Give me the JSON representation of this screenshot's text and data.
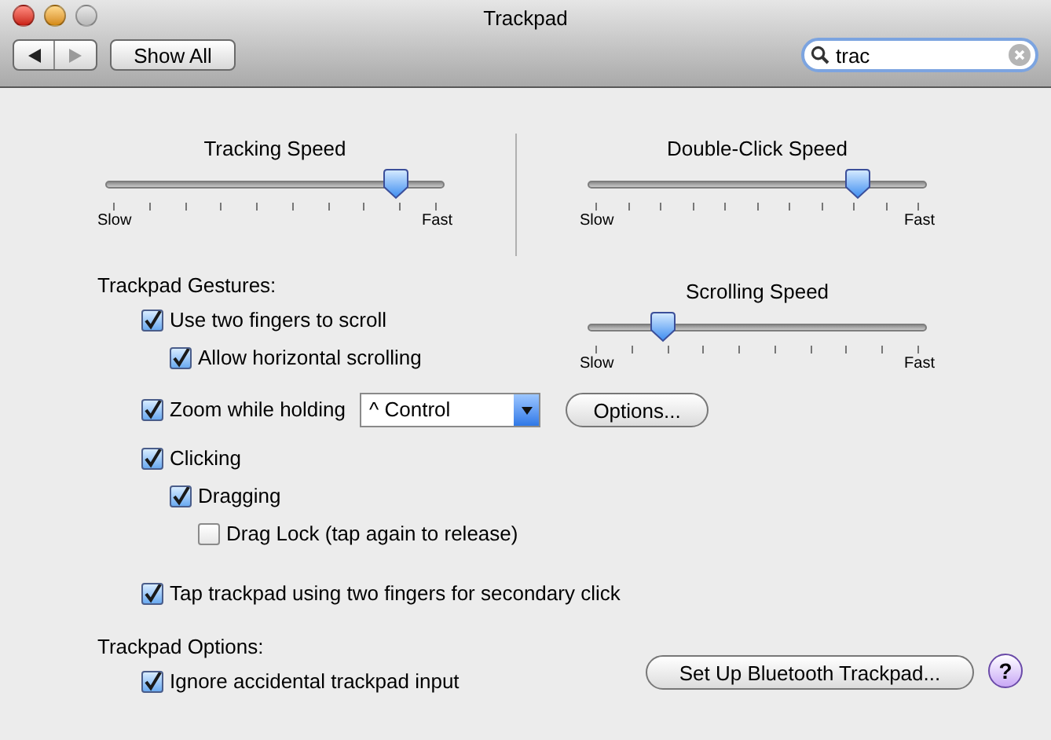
{
  "window": {
    "title": "Trackpad"
  },
  "toolbar": {
    "show_all": "Show All",
    "search": {
      "value": "trac"
    }
  },
  "sliders": [
    {
      "title": "Tracking Speed",
      "level": 0.86,
      "min_label": "Slow",
      "max_label": "Fast"
    },
    {
      "title": "Double-Click Speed",
      "level": 0.8,
      "min_label": "Slow",
      "max_label": "Fast"
    }
  ],
  "gestures": {
    "heading": "Trackpad Gestures:",
    "scrolling_speed": {
      "title": "Scrolling Speed",
      "level": 0.22,
      "min_label": "Slow",
      "max_label": "Fast"
    },
    "items": [
      {
        "kind": "checkbox",
        "label": "Use two fingers to scroll",
        "checked": true,
        "children": [
          {
            "kind": "checkbox",
            "label": "Allow horizontal scrolling",
            "checked": true
          }
        ]
      },
      {
        "kind": "checkbox_dropdown",
        "label": "Zoom while holding",
        "checked": true,
        "dropdown": "^ Control",
        "button": "Options..."
      },
      {
        "kind": "checkbox",
        "label": "Clicking",
        "checked": true,
        "children": [
          {
            "kind": "checkbox",
            "label": "Dragging",
            "checked": true,
            "children": [
              {
                "kind": "checkbox",
                "label": "Drag Lock (tap again to release)",
                "checked": false
              }
            ]
          }
        ]
      },
      {
        "kind": "checkbox",
        "label": "Tap trackpad using two fingers for secondary click",
        "checked": true
      }
    ]
  },
  "options": {
    "heading": "Trackpad Options:",
    "items": [
      {
        "kind": "checkbox",
        "label": "Ignore accidental trackpad input",
        "checked": true
      }
    ],
    "setup_button": "Set Up Bluetooth Trackpad...",
    "help_button": "?"
  }
}
